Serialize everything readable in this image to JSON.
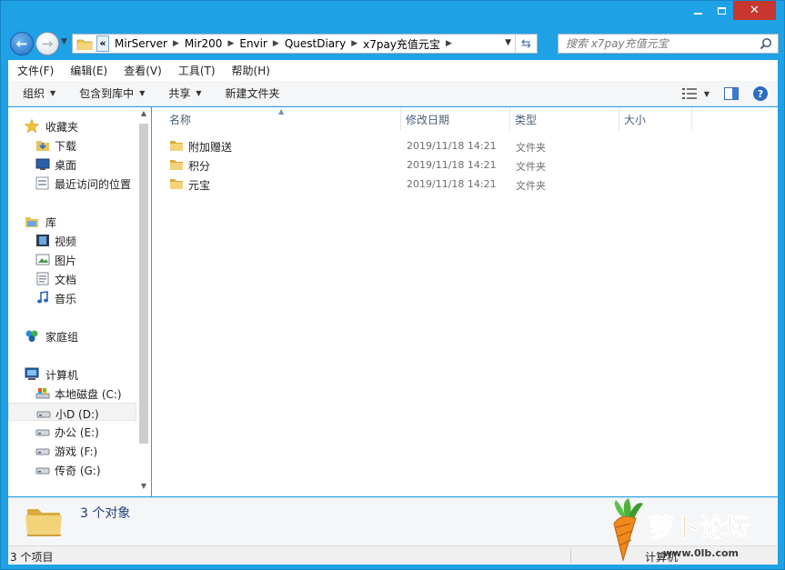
{
  "window": {
    "min_icon": "minimize-icon",
    "max_icon": "maximize-icon",
    "close_label": "✕"
  },
  "address_bar": {
    "crumbs": [
      "MirServer",
      "Mir200",
      "Envir",
      "QuestDiary",
      "x7pay充值元宝"
    ],
    "overflow_label": "«"
  },
  "search": {
    "placeholder": "搜索 x7pay充值元宝"
  },
  "menu": [
    "文件(F)",
    "编辑(E)",
    "查看(V)",
    "工具(T)",
    "帮助(H)"
  ],
  "toolbar": {
    "organize": "组织",
    "include_in_library": "包含到库中",
    "share": "共享",
    "new_folder": "新建文件夹",
    "help": "?"
  },
  "nav": {
    "favorites": {
      "label": "收藏夹",
      "items": [
        "下载",
        "桌面",
        "最近访问的位置"
      ]
    },
    "libraries": {
      "label": "库",
      "items": [
        "视频",
        "图片",
        "文档",
        "音乐"
      ]
    },
    "homegroup": "家庭组",
    "computer": {
      "label": "计算机",
      "drives": [
        "本地磁盘 (C:)",
        "小D (D:)",
        "办公 (E:)",
        "游戏 (F:)",
        "传奇 (G:)"
      ]
    },
    "selected_drive": "小D (D:)"
  },
  "columns": {
    "name": "名称",
    "modified": "修改日期",
    "type": "类型",
    "size": "大小"
  },
  "files": [
    {
      "name": "附加赠送",
      "modified": "2019/11/18 14:21",
      "type": "文件夹"
    },
    {
      "name": "积分",
      "modified": "2019/11/18 14:21",
      "type": "文件夹"
    },
    {
      "name": "元宝",
      "modified": "2019/11/18 14:21",
      "type": "文件夹"
    }
  ],
  "details": {
    "count_text": "3 个对象"
  },
  "status": {
    "item_count": "3 个项目",
    "location": "计算机"
  },
  "watermark": {
    "text": "萝卜论坛",
    "url": "www.0lb.com"
  },
  "colors": {
    "titlebar": "#1fa1e6",
    "close": "#c7372f",
    "folder": "#e8c35a"
  }
}
